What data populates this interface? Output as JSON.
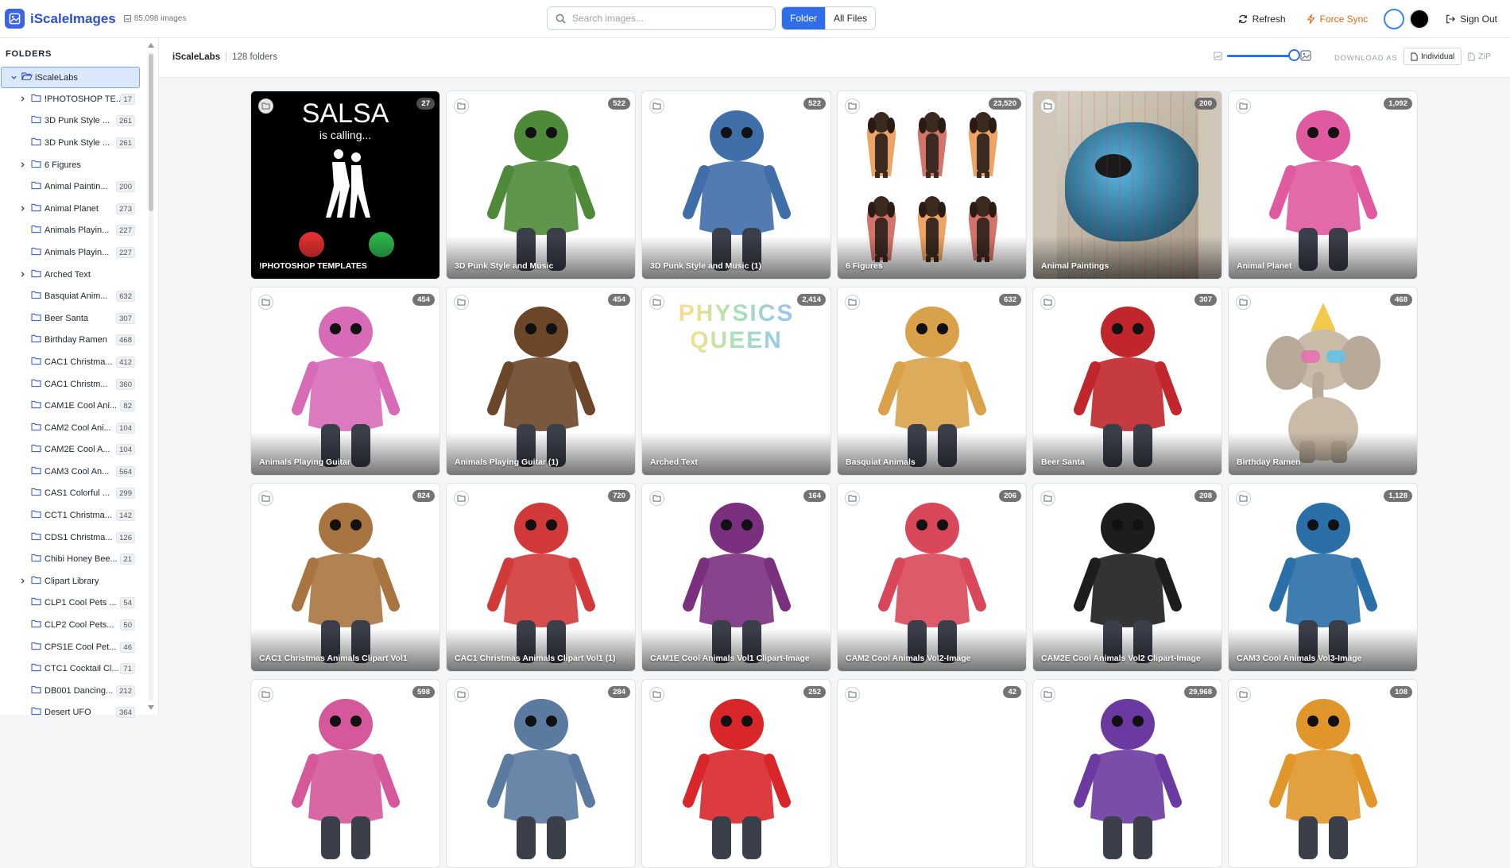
{
  "app": {
    "name": "iScaleImages",
    "image_count": "85,098 images"
  },
  "search": {
    "placeholder": "Search images..."
  },
  "view_toggle": {
    "folder": "Folder",
    "all_files": "All Files"
  },
  "header_actions": {
    "refresh": "Refresh",
    "force_sync": "Force Sync",
    "sign_out": "Sign Out"
  },
  "colors": {
    "accent": "#2f6ee8",
    "brand": "#2d4fd6",
    "force_sync": "#e06a14"
  },
  "sidebar": {
    "title": "FOLDERS",
    "root": "iScaleLabs",
    "items": [
      {
        "label": "!PHOTOSHOP TE...",
        "count": "17",
        "expandable": true
      },
      {
        "label": "3D Punk Style ...",
        "count": "261",
        "expandable": false
      },
      {
        "label": "3D Punk Style ...",
        "count": "261",
        "expandable": false
      },
      {
        "label": "6 Figures",
        "count": "",
        "expandable": true
      },
      {
        "label": "Animal Paintin...",
        "count": "200",
        "expandable": false
      },
      {
        "label": "Animal Planet",
        "count": "273",
        "expandable": true
      },
      {
        "label": "Animals Playin...",
        "count": "227",
        "expandable": false
      },
      {
        "label": "Animals Playin...",
        "count": "227",
        "expandable": false
      },
      {
        "label": "Arched Text",
        "count": "",
        "expandable": true
      },
      {
        "label": "Basquiat Anim...",
        "count": "632",
        "expandable": false
      },
      {
        "label": "Beer Santa",
        "count": "307",
        "expandable": false
      },
      {
        "label": "Birthday Ramen",
        "count": "468",
        "expandable": false
      },
      {
        "label": "CAC1 Christma...",
        "count": "412",
        "expandable": false
      },
      {
        "label": "CAC1 Christm...",
        "count": "360",
        "expandable": false
      },
      {
        "label": "CAM1E Cool Ani...",
        "count": "82",
        "expandable": false
      },
      {
        "label": "CAM2 Cool Ani...",
        "count": "104",
        "expandable": false
      },
      {
        "label": "CAM2E Cool A...",
        "count": "104",
        "expandable": false
      },
      {
        "label": "CAM3 Cool An...",
        "count": "564",
        "expandable": false
      },
      {
        "label": "CAS1 Colorful ...",
        "count": "299",
        "expandable": false
      },
      {
        "label": "CCT1 Christma...",
        "count": "142",
        "expandable": false
      },
      {
        "label": "CDS1 Christma...",
        "count": "126",
        "expandable": false
      },
      {
        "label": "Chibi Honey Bee...",
        "count": "21",
        "expandable": false
      },
      {
        "label": "Clipart Library",
        "count": "",
        "expandable": true
      },
      {
        "label": "CLP1 Cool Pets ...",
        "count": "54",
        "expandable": false
      },
      {
        "label": "CLP2 Cool Pets...",
        "count": "50",
        "expandable": false
      },
      {
        "label": "CPS1E Cool Pet...",
        "count": "46",
        "expandable": false
      },
      {
        "label": "CTC1 Cocktail Cl...",
        "count": "71",
        "expandable": false
      },
      {
        "label": "DB001 Dancing...",
        "count": "212",
        "expandable": false
      },
      {
        "label": "Desert UFO",
        "count": "364",
        "expandable": false
      }
    ]
  },
  "breadcrumb": {
    "root": "iScaleLabs",
    "folder_count": "128 folders"
  },
  "download": {
    "label": "DOWNLOAD AS",
    "individual": "Individual",
    "zip": "ZIP"
  },
  "zoom_level": 1.0,
  "cards": [
    {
      "name": "!PHOTOSHOP TEMPLATES",
      "count": "27",
      "bg": "#000000",
      "fg": "#ffffff",
      "icon": "phone-mockup-art"
    },
    {
      "name": "3D Punk Style and Music",
      "count": "522",
      "bg": "#ffffff",
      "fg": "#4f8a3a",
      "icon": "crocodile-art"
    },
    {
      "name": "3D Punk Style and Music (1)",
      "count": "522",
      "bg": "#ffffff",
      "fg": "#3f6ea8",
      "icon": "crocodile-art"
    },
    {
      "name": "6 Figures",
      "count": "23,520",
      "bg": "#ffffff",
      "fg": "#3a2a20",
      "icon": "dachshund-grid-art"
    },
    {
      "name": "Animal Paintings",
      "count": "200",
      "bg": "#cfc6b8",
      "fg": "#2f6b8a",
      "icon": "turtle-art"
    },
    {
      "name": "Animal Planet",
      "count": "1,092",
      "bg": "#ffffff",
      "fg": "#e05aa0",
      "icon": "bulldog-art"
    },
    {
      "name": "Animals Playing Guitar",
      "count": "454",
      "bg": "#ffffff",
      "fg": "#d86bb8",
      "icon": "unicorn-guitar-art"
    },
    {
      "name": "Animals Playing Guitar (1)",
      "count": "454",
      "bg": "#ffffff",
      "fg": "#6b4628",
      "icon": "dog-guitar-art"
    },
    {
      "name": "Arched Text",
      "count": "2,414",
      "bg": "#ffffff",
      "fg": "#b9a5e0",
      "icon": "arched-text-art",
      "art_text": "PHYSICS QUEEN"
    },
    {
      "name": "Basquiat Animals",
      "count": "632",
      "bg": "#ffffff",
      "fg": "#d9a24a",
      "icon": "golden-retriever-art"
    },
    {
      "name": "Beer Santa",
      "count": "307",
      "bg": "#ffffff",
      "fg": "#c0262b",
      "icon": "goat-santa-art"
    },
    {
      "name": "Birthday Ramen",
      "count": "468",
      "bg": "#ffffff",
      "fg": "#b8aa98",
      "icon": "elephant-art"
    },
    {
      "name": "CAC1 Christmas Animals Clipart Vol1",
      "count": "824",
      "bg": "#ffffff",
      "fg": "#a8743f",
      "icon": "reindeer-art"
    },
    {
      "name": "CAC1 Christmas Animals Clipart Vol1 (1)",
      "count": "720",
      "bg": "#ffffff",
      "fg": "#d23a3a",
      "icon": "fairy-art"
    },
    {
      "name": "CAM1E Cool Animals Vol1 Clipart-Image",
      "count": "164",
      "bg": "#ffffff",
      "fg": "#7a2f7f",
      "icon": "hippo-art"
    },
    {
      "name": "CAM2 Cool Animals Vol2-Image",
      "count": "206",
      "bg": "#ffffff",
      "fg": "#d8485a",
      "icon": "flamingo-art"
    },
    {
      "name": "CAM2E Cool Animals Vol2 Clipart-Image",
      "count": "208",
      "bg": "#ffffff",
      "fg": "#1d1d1d",
      "icon": "penguin-art"
    },
    {
      "name": "CAM3 Cool Animals Vol3-Image",
      "count": "1,128",
      "bg": "#ffffff",
      "fg": "#2a6fa8",
      "icon": "frenchie-art"
    },
    {
      "name": "",
      "count": "598",
      "bg": "#ffffff",
      "fg": "#d4589a",
      "icon": "colorful-art"
    },
    {
      "name": "",
      "count": "284",
      "bg": "#ffffff",
      "fg": "#5a7aa0",
      "icon": "bee-art"
    },
    {
      "name": "",
      "count": "252",
      "bg": "#ffffff",
      "fg": "#d8262b",
      "icon": "santa-hat-art"
    },
    {
      "name": "",
      "count": "42",
      "bg": "#ffffff",
      "fg": "#dddddd",
      "icon": "blank-art"
    },
    {
      "name": "",
      "count": "29,968",
      "bg": "#ffffff",
      "fg": "#6b3aa0",
      "icon": "bird-art"
    },
    {
      "name": "",
      "count": "108",
      "bg": "#ffffff",
      "fg": "#e0962a",
      "icon": "hat-art"
    }
  ]
}
